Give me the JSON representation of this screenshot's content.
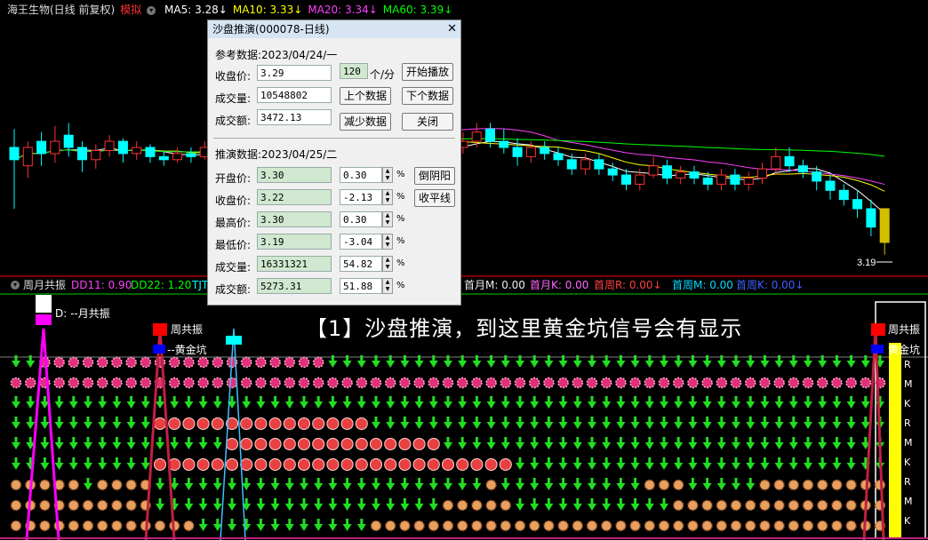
{
  "header": {
    "stock": "海王生物(日线 前复权)",
    "mode": "模拟",
    "ma5": "MA5: 3.28↓",
    "ma10": "MA10: 3.33↓",
    "ma20": "MA20: 3.34↓",
    "ma60": "MA60: 3.39↓",
    "colors": {
      "ma5": "#ffffff",
      "ma10": "#ffff00",
      "ma20": "#ff00ff",
      "ma60": "#00ff00"
    }
  },
  "main_chart": {
    "last_price_label": "3.19",
    "ylim": [
      3.1,
      3.9
    ],
    "candles": [
      [
        3.5,
        3.46,
        3.56,
        3.3
      ],
      [
        3.44,
        3.5,
        3.52,
        3.4
      ],
      [
        3.52,
        3.48,
        3.55,
        3.44
      ],
      [
        3.48,
        3.52,
        3.57,
        3.45
      ],
      [
        3.54,
        3.5,
        3.58,
        3.47
      ],
      [
        3.5,
        3.46,
        3.52,
        3.42
      ],
      [
        3.46,
        3.49,
        3.51,
        3.43
      ],
      [
        3.49,
        3.52,
        3.54,
        3.47
      ],
      [
        3.52,
        3.48,
        3.53,
        3.45
      ],
      [
        3.48,
        3.5,
        3.52,
        3.46
      ],
      [
        3.5,
        3.47,
        3.51,
        3.45
      ],
      [
        3.47,
        3.46,
        3.49,
        3.44
      ],
      [
        3.46,
        3.48,
        3.5,
        3.45
      ],
      [
        3.48,
        3.47,
        3.5,
        3.45
      ],
      [
        3.47,
        3.5,
        3.52,
        3.46
      ],
      [
        3.5,
        3.49,
        3.52,
        3.47
      ],
      [
        3.49,
        3.52,
        3.56,
        3.48
      ],
      [
        3.52,
        3.56,
        3.6,
        3.5
      ],
      [
        3.56,
        3.63,
        3.68,
        3.54
      ],
      [
        3.63,
        3.72,
        3.82,
        3.6
      ],
      [
        3.72,
        3.76,
        3.86,
        3.68
      ],
      [
        3.6,
        3.57,
        3.62,
        3.55
      ],
      [
        3.58,
        3.6,
        3.62,
        3.56
      ],
      [
        3.6,
        3.62,
        3.64,
        3.58
      ],
      [
        3.56,
        3.58,
        3.61,
        3.52
      ],
      [
        3.58,
        3.55,
        3.6,
        3.52
      ],
      [
        3.55,
        3.52,
        3.58,
        3.49
      ],
      [
        3.52,
        3.5,
        3.55,
        3.47
      ],
      [
        3.5,
        3.53,
        3.56,
        3.48
      ],
      [
        3.53,
        3.5,
        3.55,
        3.48
      ],
      [
        3.5,
        3.48,
        3.52,
        3.45
      ],
      [
        3.48,
        3.51,
        3.53,
        3.46
      ],
      [
        3.51,
        3.5,
        3.54,
        3.48
      ],
      [
        3.5,
        3.52,
        3.55,
        3.48
      ],
      [
        3.52,
        3.55,
        3.58,
        3.5
      ],
      [
        3.56,
        3.52,
        3.58,
        3.5
      ],
      [
        3.52,
        3.5,
        3.56,
        3.48
      ],
      [
        3.5,
        3.47,
        3.53,
        3.44
      ],
      [
        3.47,
        3.5,
        3.52,
        3.45
      ],
      [
        3.5,
        3.48,
        3.52,
        3.46
      ],
      [
        3.48,
        3.46,
        3.5,
        3.44
      ],
      [
        3.46,
        3.43,
        3.48,
        3.41
      ],
      [
        3.43,
        3.46,
        3.48,
        3.41
      ],
      [
        3.46,
        3.43,
        3.48,
        3.41
      ],
      [
        3.43,
        3.41,
        3.45,
        3.39
      ],
      [
        3.41,
        3.38,
        3.43,
        3.36
      ],
      [
        3.38,
        3.41,
        3.43,
        3.36
      ],
      [
        3.41,
        3.44,
        3.47,
        3.4
      ],
      [
        3.44,
        3.4,
        3.46,
        3.38
      ],
      [
        3.4,
        3.42,
        3.44,
        3.38
      ],
      [
        3.42,
        3.4,
        3.44,
        3.38
      ],
      [
        3.4,
        3.38,
        3.42,
        3.36
      ],
      [
        3.38,
        3.41,
        3.43,
        3.36
      ],
      [
        3.41,
        3.38,
        3.43,
        3.36
      ],
      [
        3.38,
        3.4,
        3.42,
        3.36
      ],
      [
        3.4,
        3.43,
        3.45,
        3.38
      ],
      [
        3.43,
        3.47,
        3.5,
        3.41
      ],
      [
        3.47,
        3.44,
        3.5,
        3.42
      ],
      [
        3.44,
        3.42,
        3.46,
        3.4
      ],
      [
        3.42,
        3.39,
        3.44,
        3.36
      ],
      [
        3.39,
        3.36,
        3.41,
        3.33
      ],
      [
        3.36,
        3.33,
        3.38,
        3.31
      ],
      [
        3.33,
        3.3,
        3.36,
        3.27
      ],
      [
        3.3,
        3.24,
        3.33,
        3.21
      ],
      [
        3.3,
        3.19,
        3.3,
        3.15
      ]
    ]
  },
  "indicator_header": {
    "title": "周月共振",
    "dd11": "DD11: 0.90",
    "dd22": "DD22: 1.20",
    "tjt": "TJT",
    "shouyuem": "首月M: 0.00",
    "shouyuek": "首月K: 0.00",
    "shouzhour": "首周R: 0.00↓",
    "shouzhoum": "首周M: 0.00",
    "shouzhouk": "首周K: 0.00↓"
  },
  "indicator": {
    "banner": "【1】沙盘推演，到这里黄金坑信号会有显示",
    "legend_yuegongzhen": "D: --月共振",
    "legend_zhougongzhen": "周共振",
    "legend_huangjinkeng": "--黄金坑",
    "right_zhougongzhen": "周共振",
    "right_huangjinkeng": "黄金坑",
    "side_letters": [
      "R",
      "M",
      "K",
      "R",
      "M",
      "K",
      "R",
      "M",
      "K"
    ]
  },
  "dialog": {
    "title": "沙盘推演(000078-日线)",
    "close": "✕",
    "ref_label": "参考数据:2023/04/24/一",
    "close_price_label": "收盘价:",
    "close_price": "3.29",
    "volume_label": "成交量:",
    "volume": "10548802",
    "amount_label": "成交额:",
    "amount": "3472.13",
    "speed": "120",
    "speed_unit": "个/分",
    "btn_play": "开始播放",
    "btn_prev": "上个数据",
    "btn_next": "下个数据",
    "btn_reduce": "减少数据",
    "btn_close": "关闭",
    "sim_label": "推演数据:2023/04/25/二",
    "rows": [
      {
        "label": "开盘价:",
        "value": "3.30",
        "pct": "0.30"
      },
      {
        "label": "收盘价:",
        "value": "3.22",
        "pct": "-2.13"
      },
      {
        "label": "最高价:",
        "value": "3.30",
        "pct": "0.30"
      },
      {
        "label": "最低价:",
        "value": "3.19",
        "pct": "-3.04"
      },
      {
        "label": "成交量:",
        "value": "16331321",
        "pct": "54.82"
      },
      {
        "label": "成交额:",
        "value": "5273.31",
        "pct": "51.88"
      }
    ],
    "pct_sign": "%",
    "btn_invert": "倒阴阳",
    "btn_flat": "收平线"
  }
}
